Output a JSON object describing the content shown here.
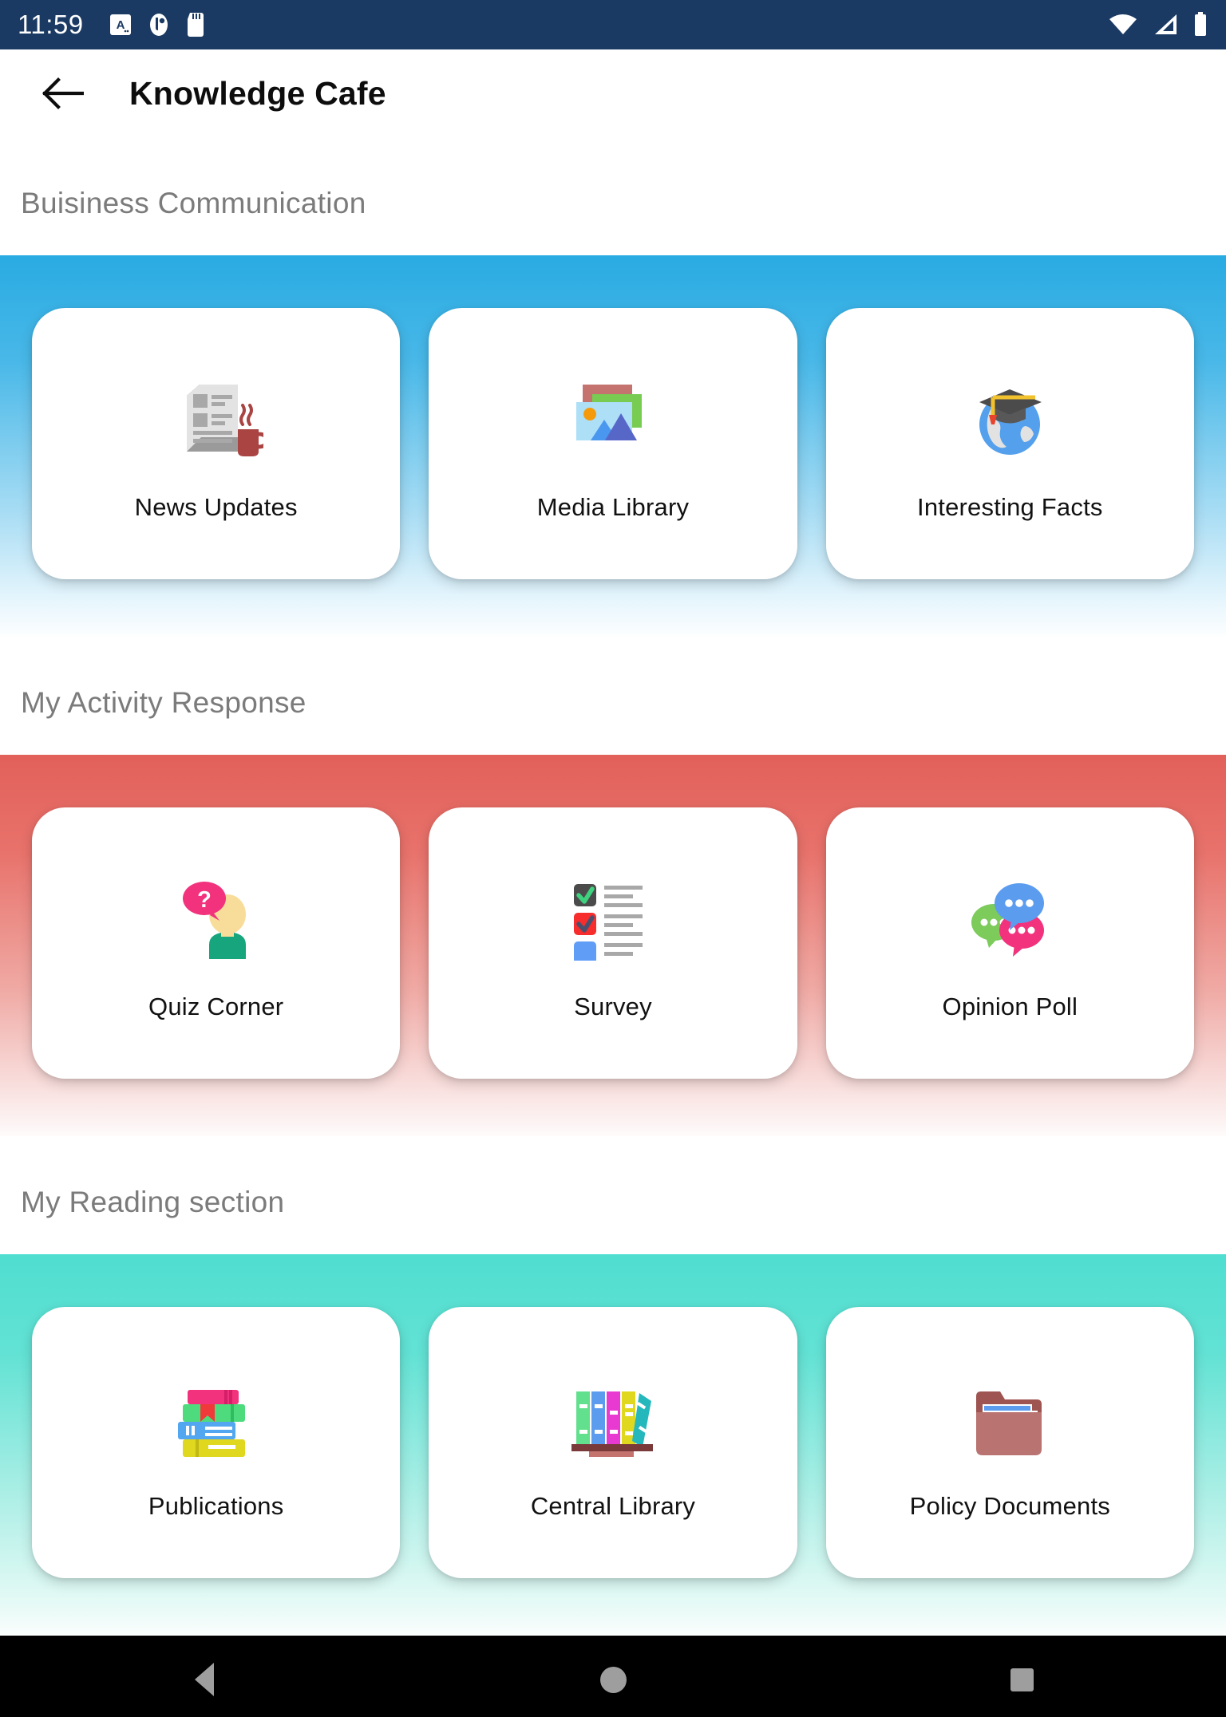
{
  "status_bar": {
    "time": "11:59",
    "left_icons": [
      "alphabet-mode-icon",
      "app-notification-icon",
      "sd-card-icon"
    ],
    "right_icons": [
      "wifi-icon",
      "cellular-signal-icon",
      "battery-icon"
    ],
    "background_color": "#1b3a63"
  },
  "app_bar": {
    "back_label": "back-arrow",
    "title": "Knowledge Cafe"
  },
  "sections": [
    {
      "title": "Buisiness Communication",
      "accent_color": "#29ABE2",
      "cards": [
        {
          "label": "News Updates",
          "icon": "newspaper-coffee-icon"
        },
        {
          "label": "Media Library",
          "icon": "photo-stack-icon"
        },
        {
          "label": "Interesting Facts",
          "icon": "globe-graduation-cap-icon"
        }
      ]
    },
    {
      "title": "My Activity Response",
      "accent_color": "#e2605a",
      "cards": [
        {
          "label": "Quiz Corner",
          "icon": "person-question-bubble-icon"
        },
        {
          "label": "Survey",
          "icon": "checklist-icon"
        },
        {
          "label": "Opinion Poll",
          "icon": "speech-bubbles-icon"
        }
      ]
    },
    {
      "title": "My Reading section",
      "accent_color": "#4fded0",
      "cards": [
        {
          "label": "Publications",
          "icon": "book-stack-icon"
        },
        {
          "label": "Central Library",
          "icon": "bookshelf-icon"
        },
        {
          "label": "Policy Documents",
          "icon": "folder-documents-icon"
        }
      ]
    }
  ],
  "nav_bar": {
    "back": "back-triangle",
    "home": "home-circle",
    "recents": "recents-square"
  }
}
